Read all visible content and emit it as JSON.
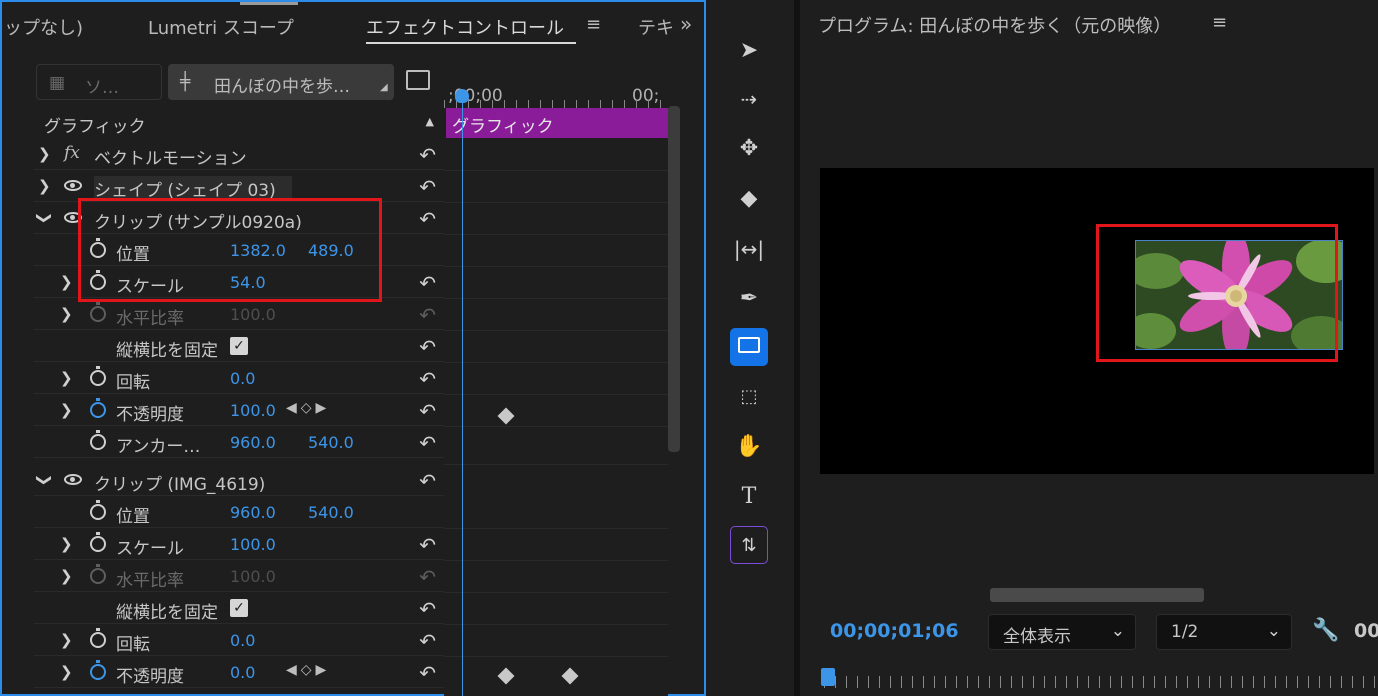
{
  "tabs": {
    "tab1": "ップなし)",
    "tab2": "Lumetri スコープ",
    "tab3": "エフェクトコントロール",
    "tab3_menu": "≡",
    "tab4": "テキ",
    "overflow": "»"
  },
  "source_selector": {
    "label": "ソ…"
  },
  "sequence_selector": {
    "label": "田んぼの中を歩…"
  },
  "section": {
    "label": "グラフィック"
  },
  "props": {
    "vector_motion": "ベクトルモーション",
    "shape": "シェイプ (シェイプ 03)",
    "clip1": "クリップ (サンプル0920a)",
    "clip1_position": {
      "label": "位置",
      "x": "1382.0",
      "y": "489.0"
    },
    "clip1_scale": {
      "label": "スケール",
      "value": "54.0"
    },
    "clip1_hscale": {
      "label": "水平比率",
      "value": "100.0"
    },
    "clip1_uniform": {
      "label": "縦横比を固定"
    },
    "clip1_rotation": {
      "label": "回転",
      "value": "0.0"
    },
    "clip1_opacity": {
      "label": "不透明度",
      "value": "100.0"
    },
    "clip1_anchor": {
      "label": "アンカー…",
      "x": "960.0",
      "y": "540.0"
    },
    "clip2": "クリップ (IMG_4619)",
    "clip2_position": {
      "label": "位置",
      "x": "960.0",
      "y": "540.0"
    },
    "clip2_scale": {
      "label": "スケール",
      "value": "100.0"
    },
    "clip2_hscale": {
      "label": "水平比率",
      "value": "100.0"
    },
    "clip2_uniform": {
      "label": "縦横比を固定"
    },
    "clip2_rotation": {
      "label": "回転",
      "value": "0.0"
    },
    "clip2_opacity": {
      "label": "不透明度",
      "value": "0.0"
    }
  },
  "timeline": {
    "start_tc": ";00;00",
    "end_tc": "00;",
    "clip_label": "グラフィック"
  },
  "program_monitor": {
    "title": "プログラム: 田んぼの中を歩く（元の映像）",
    "menu": "≡",
    "timecode": "00;00;01;06",
    "fit_dropdown": "全体表示",
    "resolution_dropdown": "1/2",
    "right_timecode": "00"
  },
  "tools": [
    "selection-tool",
    "track-select-forward-tool",
    "ripple-edit-tool",
    "razor-tool",
    "slip-tool",
    "pen-tool",
    "rectangle-tool",
    "subselect-tool",
    "hand-tool",
    "type-tool",
    "vertical-type-tool"
  ],
  "colors": {
    "accent": "#3d95e8",
    "clip_bar": "#8a1c9a",
    "highlight_box": "#e0161b",
    "panel_border": "#2d8ceb"
  }
}
